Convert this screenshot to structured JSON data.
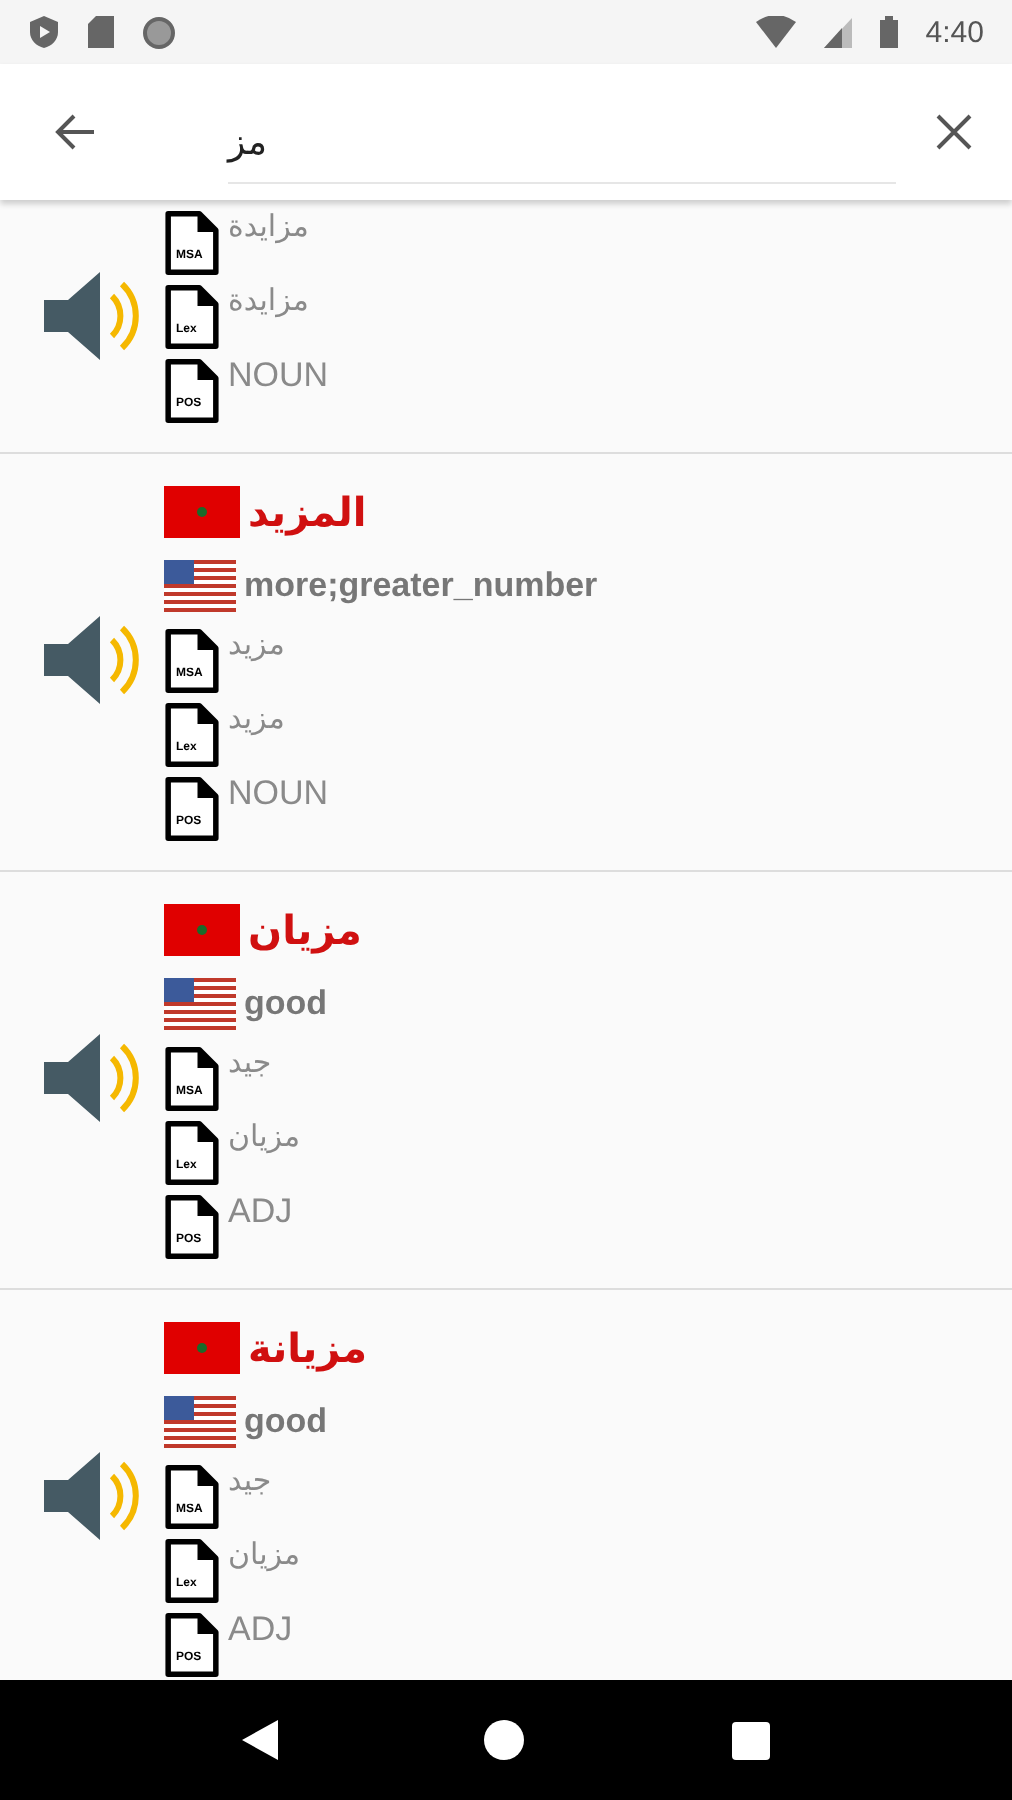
{
  "status_bar": {
    "time": "4:40"
  },
  "search": {
    "value": "مز"
  },
  "entries": [
    {
      "rows": [
        {
          "tag": "MSA",
          "text": "مزايدة",
          "kind": "arabic"
        },
        {
          "tag": "Lex",
          "text": "مزايدة",
          "kind": "arabic"
        },
        {
          "tag": "POS",
          "text": "NOUN",
          "kind": "latin"
        }
      ]
    },
    {
      "headword": "المزيد",
      "translation": "more;greater_number",
      "rows": [
        {
          "tag": "MSA",
          "text": "مزيد",
          "kind": "arabic"
        },
        {
          "tag": "Lex",
          "text": "مزيد",
          "kind": "arabic"
        },
        {
          "tag": "POS",
          "text": "NOUN",
          "kind": "latin"
        }
      ]
    },
    {
      "headword": "مزيان",
      "translation": "good",
      "rows": [
        {
          "tag": "MSA",
          "text": "جيد",
          "kind": "arabic"
        },
        {
          "tag": "Lex",
          "text": "مزيان",
          "kind": "arabic"
        },
        {
          "tag": "POS",
          "text": "ADJ",
          "kind": "latin"
        }
      ]
    },
    {
      "headword": "مزيانة",
      "translation": "good",
      "rows": [
        {
          "tag": "MSA",
          "text": "جيد",
          "kind": "arabic"
        },
        {
          "tag": "Lex",
          "text": "مزيان",
          "kind": "arabic"
        },
        {
          "tag": "POS",
          "text": "ADJ",
          "kind": "latin"
        }
      ]
    }
  ]
}
